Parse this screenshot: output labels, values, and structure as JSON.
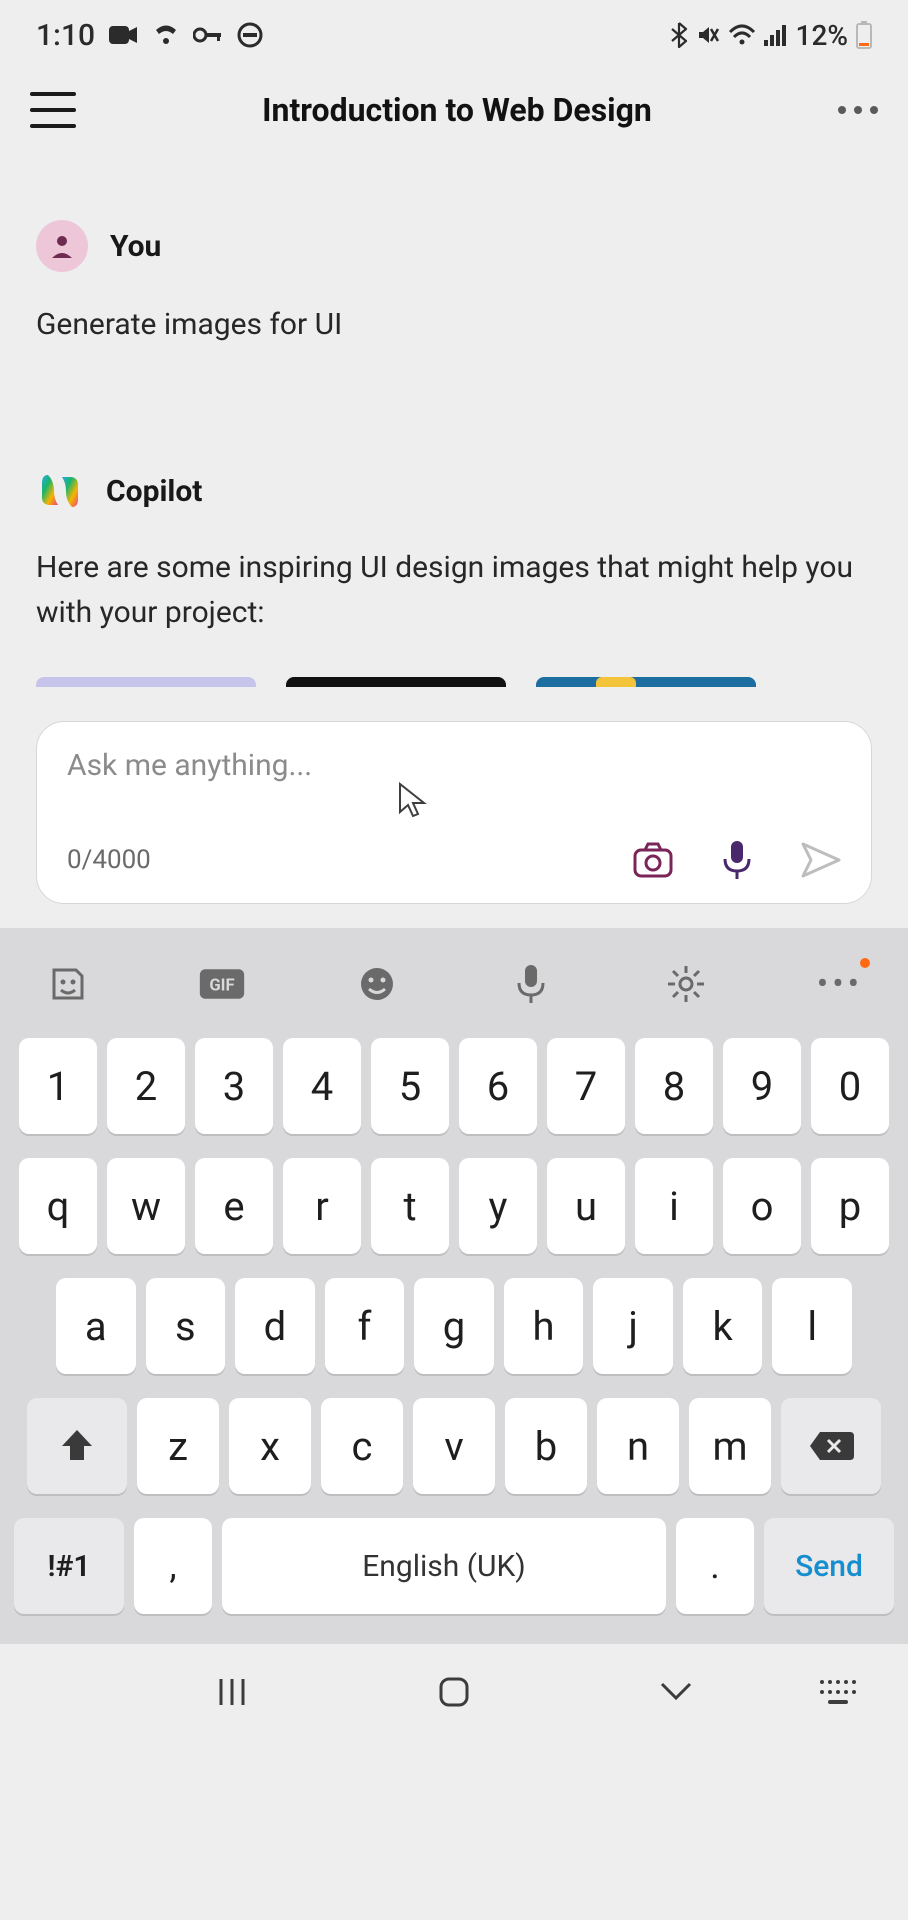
{
  "status_bar": {
    "time": "1:10",
    "battery_text": "12%"
  },
  "header": {
    "title": "Introduction to Web Design"
  },
  "chat": {
    "user": {
      "sender": "You",
      "text": "Generate images for UI"
    },
    "assistant": {
      "sender": "Copilot",
      "text": "Here are some inspiring UI design images that might help you with your project:",
      "thumb_colors": [
        "#c7c4ec",
        "#111111",
        "#1c6da0"
      ],
      "thumb_accent": "#f3c33a"
    }
  },
  "input": {
    "placeholder": "Ask me anything...",
    "counter": "0/4000"
  },
  "keyboard": {
    "row_num": [
      "1",
      "2",
      "3",
      "4",
      "5",
      "6",
      "7",
      "8",
      "9",
      "0"
    ],
    "row_q": [
      "q",
      "w",
      "e",
      "r",
      "t",
      "y",
      "u",
      "i",
      "o",
      "p"
    ],
    "row_a": [
      "a",
      "s",
      "d",
      "f",
      "g",
      "h",
      "j",
      "k",
      "l"
    ],
    "row_z": [
      "z",
      "x",
      "c",
      "v",
      "b",
      "n",
      "m"
    ],
    "sym_label": "!#1",
    "space_label": "English (UK)",
    "send_label": "Send",
    "comma": ",",
    "period": "."
  }
}
